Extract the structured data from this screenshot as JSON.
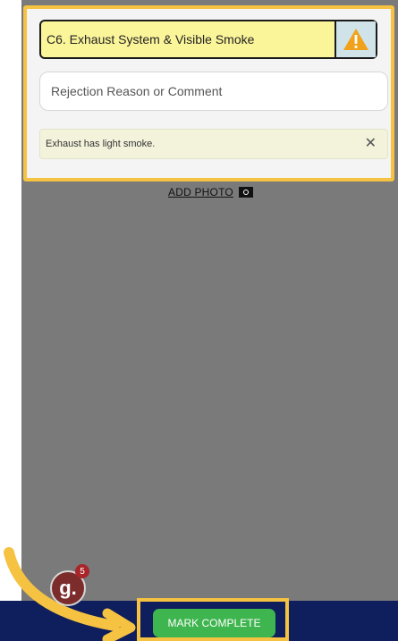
{
  "item": {
    "title": "C6. Exhaust System & Visible Smoke",
    "status_icon": "warning-triangle-icon"
  },
  "comment": {
    "placeholder": "Rejection Reason or Comment"
  },
  "note": {
    "text": "Exhaust has light smoke.",
    "close": "✕"
  },
  "add_photo": {
    "label": "ADD PHOTO",
    "icon": "camera-icon"
  },
  "footer": {
    "button_label": "MARK COMPLETE"
  },
  "logo": {
    "letter": "g.",
    "badge": "5"
  },
  "colors": {
    "highlight": "#f5c242",
    "footer_bg": "#0f1e5c",
    "button": "#3fb54f",
    "field_bg": "#fbf59a"
  }
}
